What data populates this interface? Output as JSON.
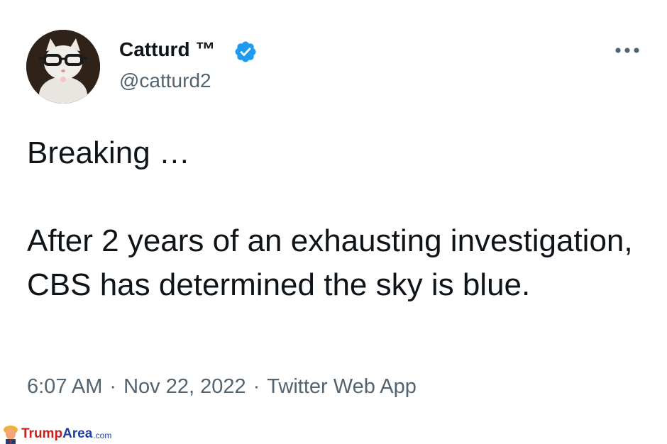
{
  "author": {
    "display_name": "Catturd ™",
    "handle": "@catturd2",
    "verified": true,
    "verified_icon": "verified-badge-icon",
    "verified_color": "#1d9bf0",
    "avatar": "cat-with-glasses-avatar"
  },
  "menu": {
    "icon": "more-options-icon"
  },
  "tweet": {
    "text": "Breaking …\n\nAfter 2 years of an exhausting investigation, CBS has determined the sky is blue."
  },
  "meta": {
    "time": "6:07 AM",
    "date": "Nov 22, 2022",
    "source": "Twitter Web App",
    "separator": "·"
  },
  "watermark": {
    "brand_part1": "Trump",
    "brand_part2": "Area",
    "brand_suffix": ".com",
    "icon": "trump-caricature-icon"
  },
  "colors": {
    "text": "#0f1419",
    "secondary": "#536471",
    "accent": "#1d9bf0",
    "watermark_red": "#c81e1e",
    "watermark_blue": "#1f3fa8"
  }
}
